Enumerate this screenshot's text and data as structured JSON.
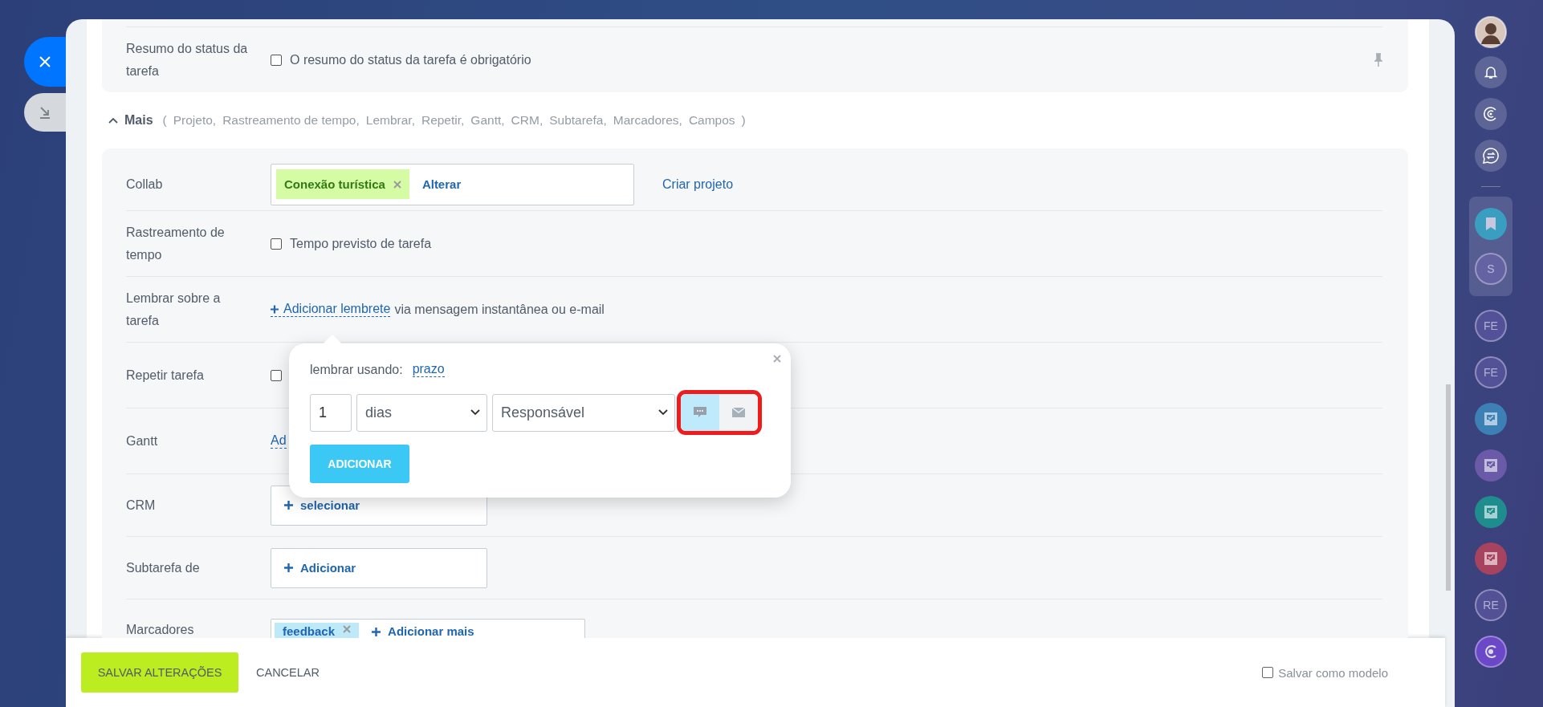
{
  "top_section": {
    "label": "Resumo do status da tarefa",
    "checkbox": {
      "label": "O resumo do status da tarefa é obrigatório",
      "checked": false
    }
  },
  "more": {
    "label": "Mais",
    "expanded": true,
    "open": "(",
    "items": [
      "Projeto,",
      "Rastreamento de tempo,",
      "Lembrar,",
      "Repetir,",
      "Gantt,",
      "CRM,",
      "Subtarefa,",
      "Marcadores,",
      "Campos"
    ],
    "close": ")"
  },
  "rows": [
    {
      "kind": "collab",
      "label": "Collab",
      "tag": "Conexão turística",
      "action": "Alterar",
      "side_link": "Criar projeto"
    },
    {
      "kind": "checkbox",
      "label": "Rastreamento de tempo",
      "text": "Tempo previsto de tarefa",
      "checked": false
    },
    {
      "kind": "reminder",
      "label": "Lembrar sobre a tarefa",
      "link": "Adicionar lembrete",
      "text": "via mensagem instantânea ou e-mail"
    },
    {
      "kind": "checkbox",
      "label": "Repetir tarefa",
      "checked": false
    },
    {
      "kind": "link",
      "label": "Gantt",
      "link": "Ad"
    },
    {
      "kind": "picker",
      "label": "CRM",
      "action": "selecionar"
    },
    {
      "kind": "picker",
      "label": "Subtarefa de",
      "action": "Adicionar"
    },
    {
      "kind": "tags",
      "label": "Marcadores",
      "tag": "feedback",
      "action": "Adicionar mais"
    }
  ],
  "popup": {
    "label": "lembrar usando:",
    "mode_link": "prazo",
    "amount": "1",
    "unit": "dias",
    "recipient": "Responsável",
    "channels": [
      {
        "kind": "chat",
        "selected": true
      },
      {
        "kind": "email",
        "selected": false
      }
    ],
    "submit": "ADICIONAR"
  },
  "footer": {
    "save": "SALVAR ALTERAÇÕES",
    "cancel": "CANCELAR",
    "template": {
      "label": "Salvar como modelo",
      "checked": false
    }
  },
  "rail": {
    "top": [
      {
        "kind": "avatar"
      },
      {
        "kind": "bell"
      },
      {
        "kind": "swirl"
      },
      {
        "kind": "chat-swap"
      }
    ],
    "pinned": [
      {
        "kind": "bookmark"
      },
      {
        "kind": "initials",
        "text": "S"
      }
    ],
    "items": [
      {
        "kind": "initials",
        "text": "FE"
      },
      {
        "kind": "initials",
        "text": "FE"
      },
      {
        "kind": "task",
        "color": "#3d80b6"
      },
      {
        "kind": "task",
        "color": "#6a5aa8"
      },
      {
        "kind": "task",
        "color": "#1f8c8e"
      },
      {
        "kind": "task",
        "color": "#a8435f"
      },
      {
        "kind": "initials",
        "text": "RE"
      },
      {
        "kind": "logo"
      }
    ]
  }
}
